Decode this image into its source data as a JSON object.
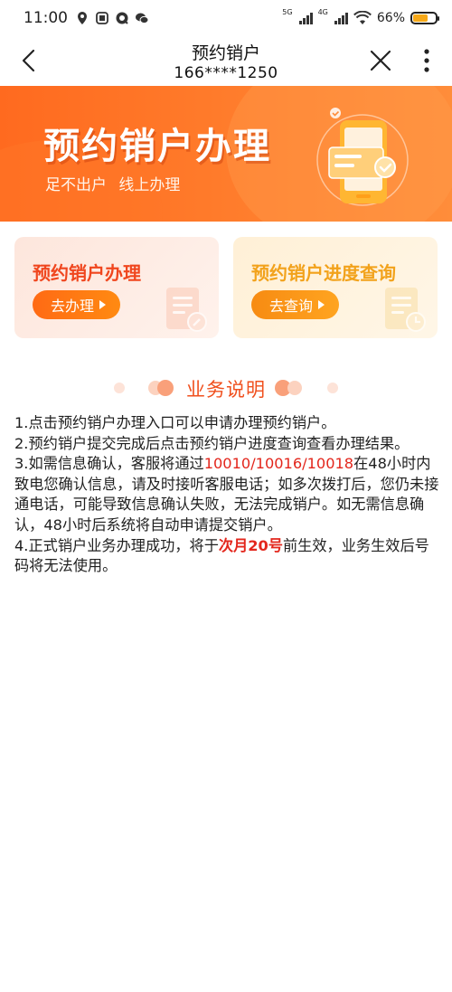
{
  "status_bar": {
    "time": "11:00",
    "network_1": "5G",
    "network_2": "4G",
    "battery": "66%",
    "icons": [
      "location-icon",
      "sim-card-icon",
      "message-icon",
      "wechat-icon",
      "wifi-icon",
      "battery-icon"
    ]
  },
  "nav": {
    "title": "预约销户",
    "subtitle": "166****1250",
    "icons": [
      "back-arrow-icon",
      "close-icon",
      "more-vertical-icon"
    ]
  },
  "banner": {
    "title": "预约销户办理",
    "subtitle": "足不出户  线上办理"
  },
  "cards": [
    {
      "title": "预约销户办理",
      "button": "去办理",
      "color": "#f0461e"
    },
    {
      "title": "预约销户进度查询",
      "button": "去查询",
      "color": "#f2a21b"
    }
  ],
  "section": {
    "title": "业务说明"
  },
  "instructions": {
    "item1": "1.点击预约销户办理入口可以申请办理预约销户。",
    "item2": "2.预约销户提交完成后点击预约销户进度查询查看办理结果。",
    "item3_prefix": "3.如需信息确认，客服将通过",
    "item3_numbers": "10010/10016/10018",
    "item3_suffix": "在48小时内致电您确认信息，请及时接听客服电话；如多次拨打后，您仍未接通电话，可能导致信息确认失败，无法完成销户。如无需信息确认，48小时后系统将自动申请提交销户。",
    "item4_prefix": "4.正式销户业务办理成功，将于",
    "item4_highlight": "次月20号",
    "item4_suffix": "前生效，业务生效后号码将无法使用。"
  },
  "colors": {
    "brand_orange": "#ff6a1f",
    "accent_red": "#e3261c",
    "accent_amber": "#f2a21b"
  }
}
